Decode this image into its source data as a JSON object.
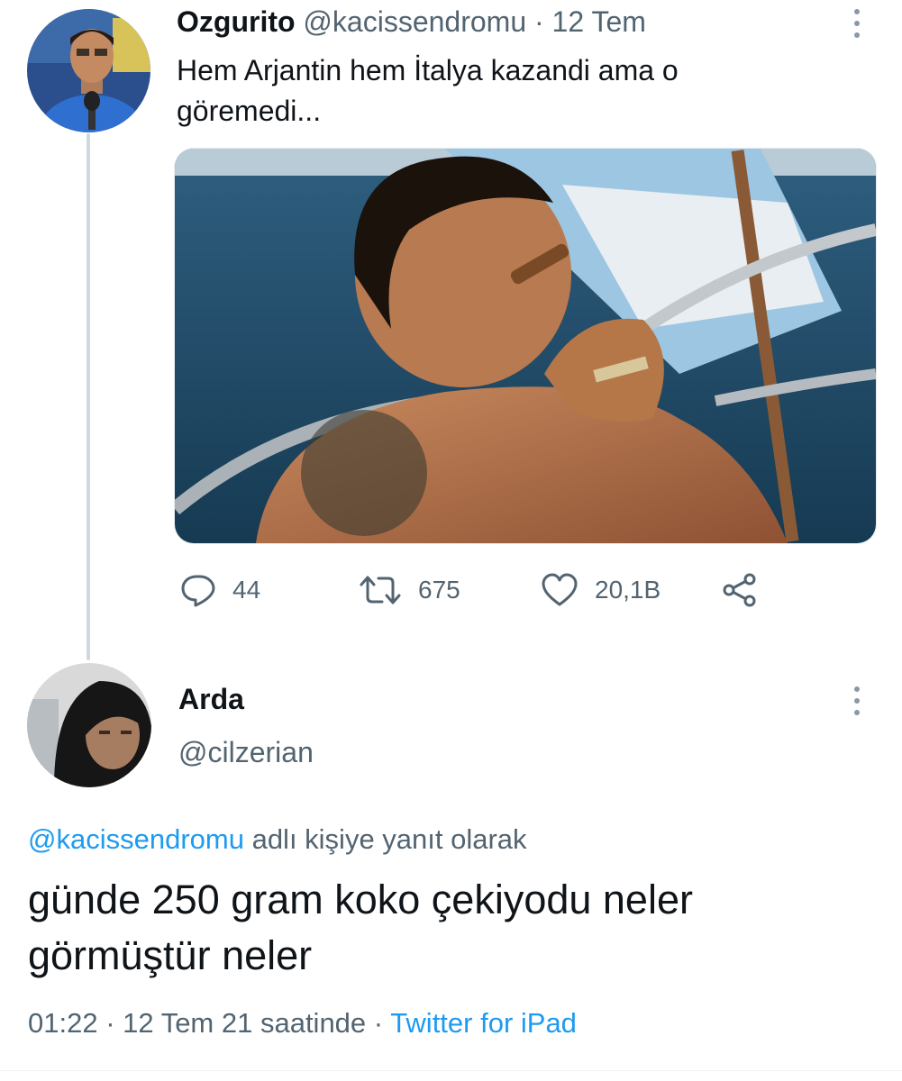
{
  "tweet_main": {
    "display_name": "Ozgurito",
    "handle": "@kacissendromu",
    "separator": "·",
    "date": "12 Tem",
    "text": "Hem Arjantin hem İtalya kazandi ama o göremedi...",
    "media": {
      "description_icon": "photo"
    },
    "actions": {
      "reply_count": "44",
      "retweet_count": "675",
      "like_count": "20,1B"
    },
    "icons": [
      "reply-icon",
      "retweet-icon",
      "like-icon",
      "share-icon",
      "more-icon"
    ]
  },
  "tweet_reply": {
    "display_name": "Arda",
    "handle": "@cilzerian",
    "replying_to_handle": "@kacissendromu",
    "replying_to_suffix": "adlı kişiye yanıt olarak",
    "text": "günde 250 gram koko çekiyodu neler görmüştür neler",
    "time": "01:22",
    "separator": "·",
    "date": "12 Tem 21 saatinde",
    "source": "Twitter for iPad"
  },
  "colors": {
    "accent": "#1d9bf0",
    "muted": "#536471",
    "text": "#0f1419",
    "thread_line": "#cfd9de"
  }
}
